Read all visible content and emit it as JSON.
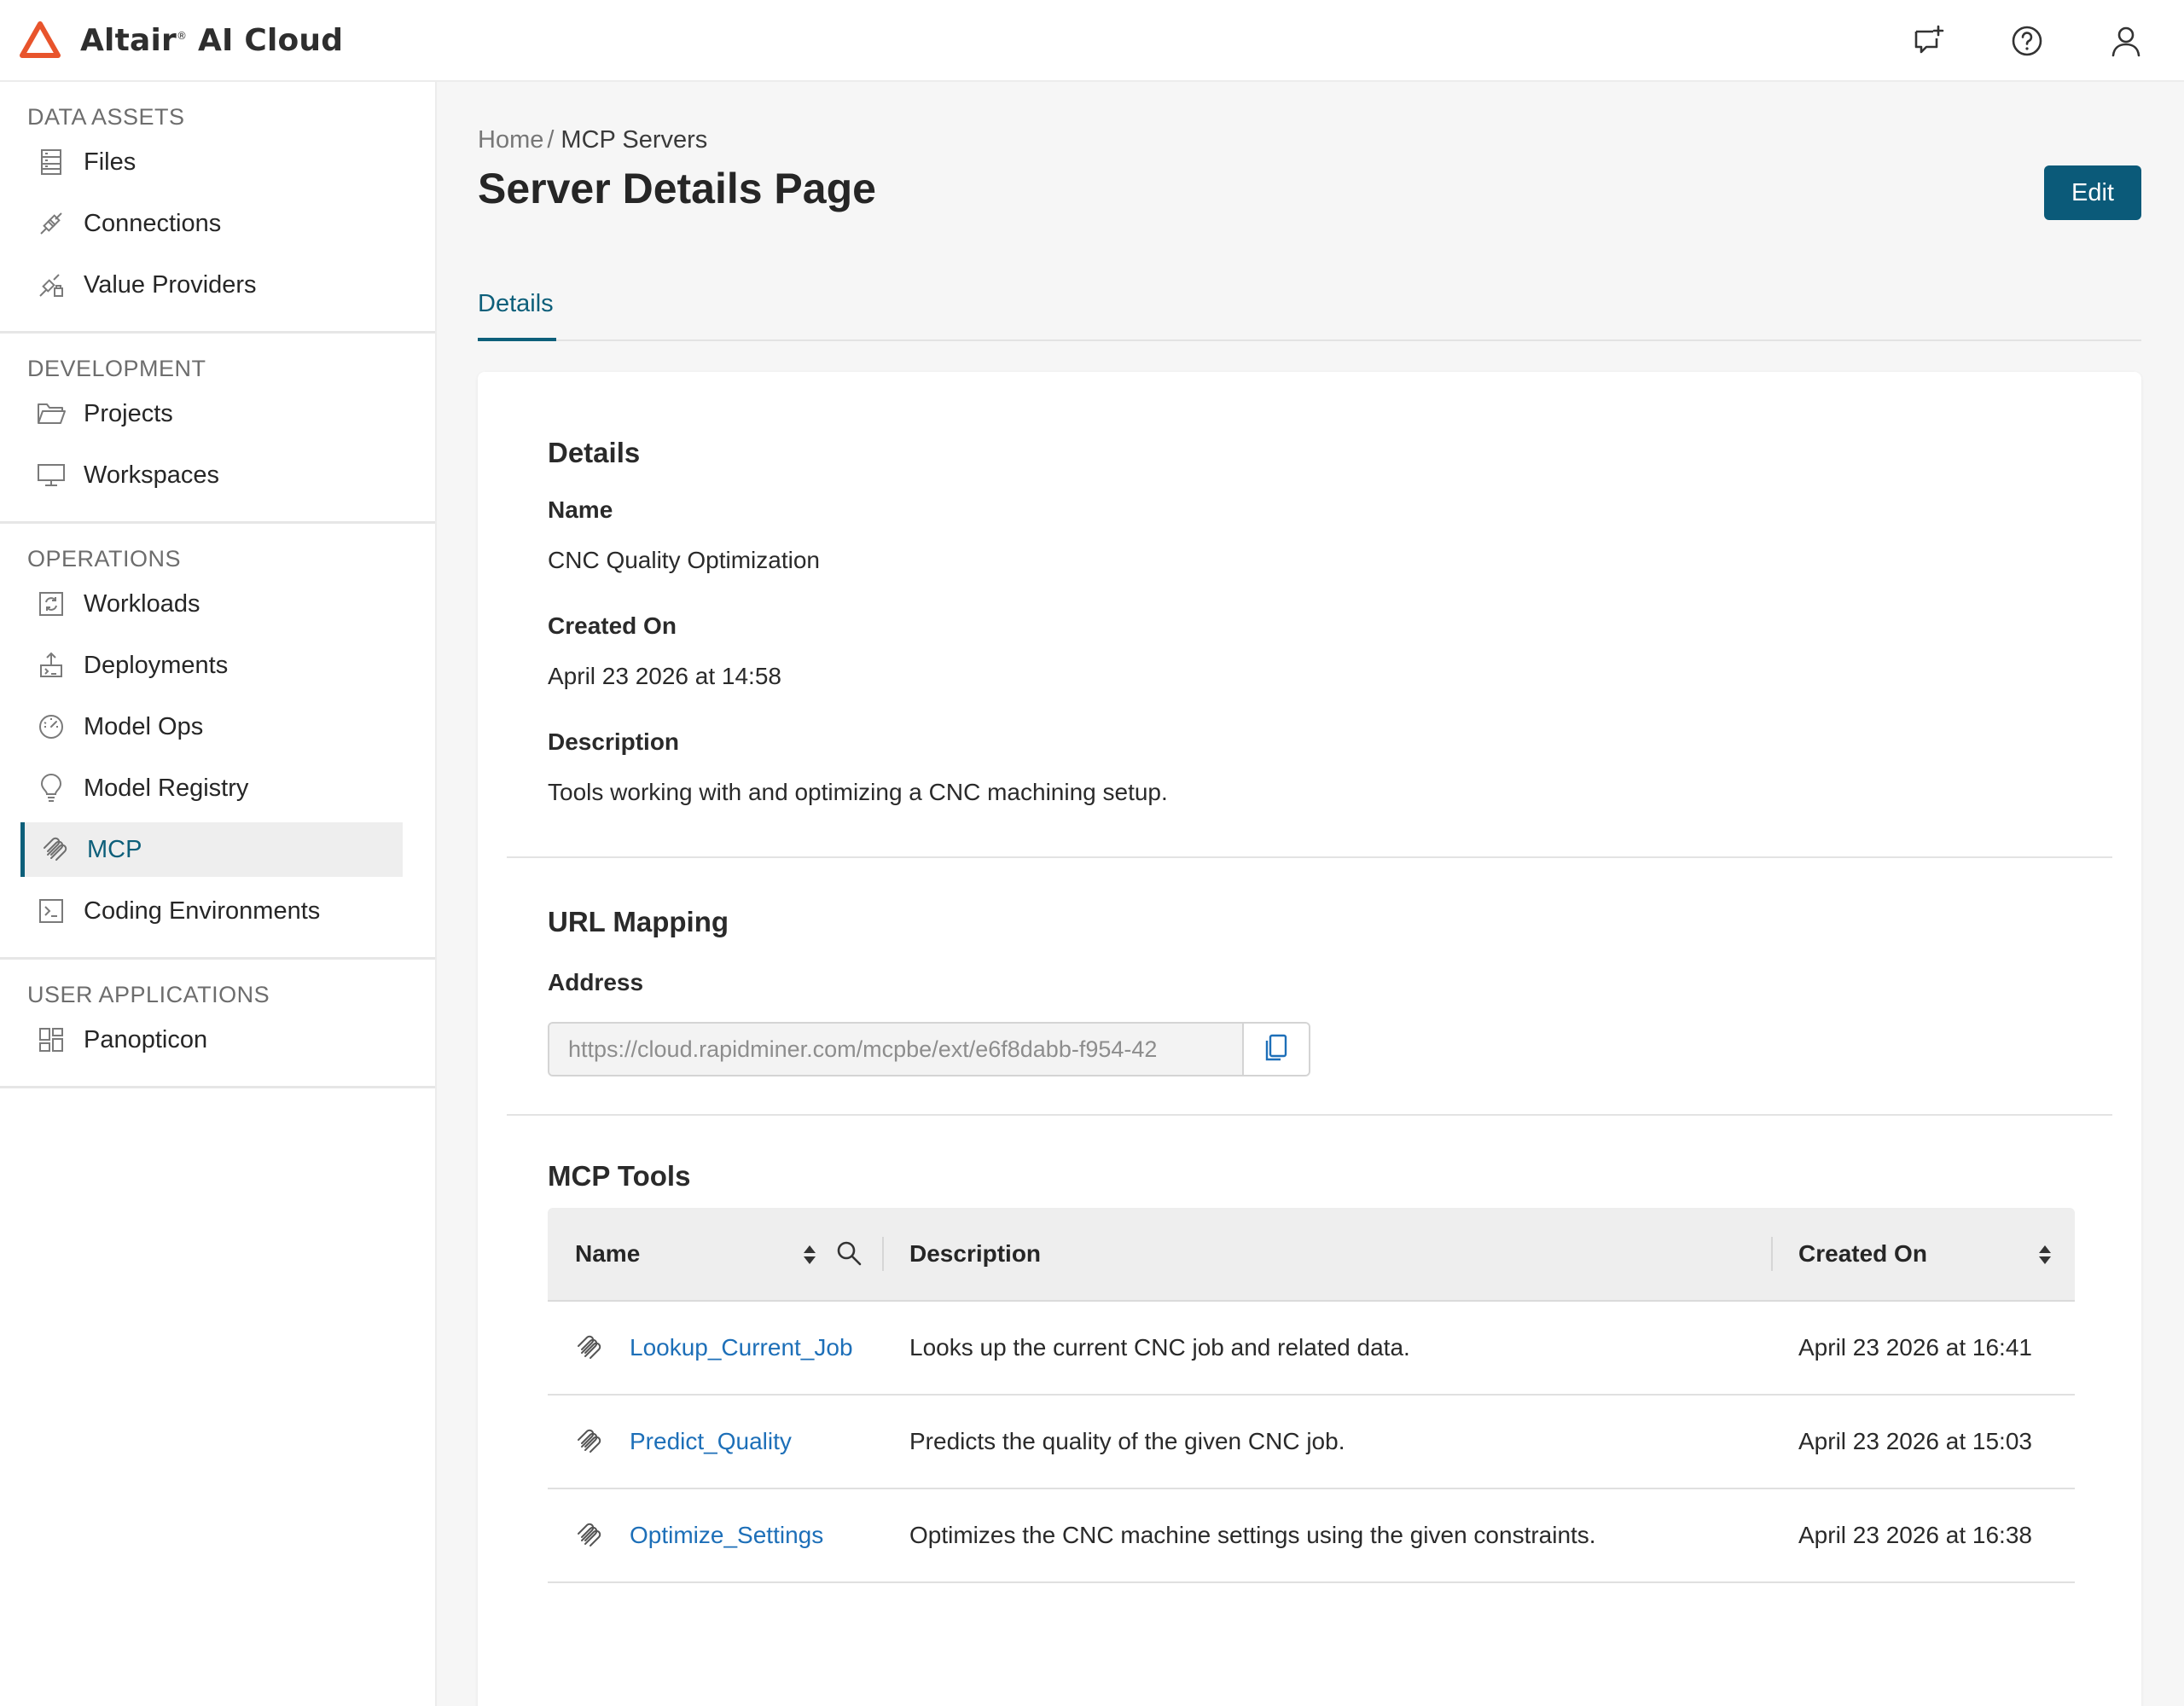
{
  "header": {
    "brand_name": "Altair",
    "brand_suffix": "AI Cloud",
    "brand_color": "#E8542C",
    "icons": [
      "feedback-icon",
      "help-icon",
      "user-icon"
    ]
  },
  "sidebar": {
    "sections": [
      {
        "title": "DATA ASSETS",
        "items": [
          {
            "label": "Files",
            "icon": "files-icon"
          },
          {
            "label": "Connections",
            "icon": "connections-icon"
          },
          {
            "label": "Value Providers",
            "icon": "value-providers-icon"
          }
        ]
      },
      {
        "title": "DEVELOPMENT",
        "items": [
          {
            "label": "Projects",
            "icon": "folder-icon"
          },
          {
            "label": "Workspaces",
            "icon": "monitor-icon"
          }
        ]
      },
      {
        "title": "OPERATIONS",
        "items": [
          {
            "label": "Workloads",
            "icon": "workloads-icon"
          },
          {
            "label": "Deployments",
            "icon": "deployments-icon"
          },
          {
            "label": "Model Ops",
            "icon": "gauge-icon"
          },
          {
            "label": "Model Registry",
            "icon": "lightbulb-icon"
          },
          {
            "label": "MCP",
            "icon": "mcp-icon",
            "active": true
          },
          {
            "label": "Coding Environments",
            "icon": "terminal-icon"
          }
        ]
      },
      {
        "title": "USER APPLICATIONS",
        "items": [
          {
            "label": "Panopticon",
            "icon": "dashboard-icon"
          }
        ]
      }
    ]
  },
  "breadcrumb": {
    "home": "Home",
    "separator": "/",
    "current": "MCP Servers"
  },
  "page": {
    "title": "Server Details Page",
    "edit_label": "Edit",
    "accent_color": "#0B5A79"
  },
  "tabs": [
    {
      "label": "Details",
      "active": true
    }
  ],
  "details": {
    "title": "Details",
    "name_label": "Name",
    "name_value": "CNC Quality Optimization",
    "created_label": "Created On",
    "created_value": "April 23 2026 at 14:58",
    "description_label": "Description",
    "description_value": "Tools working with and optimizing a CNC machining setup."
  },
  "url_mapping": {
    "title": "URL Mapping",
    "address_label": "Address",
    "address_value": "https://cloud.rapidminer.com/mcpbe/ext/e6f8dabb-f954-42"
  },
  "mcp_tools": {
    "title": "MCP Tools",
    "columns": {
      "name": "Name",
      "description": "Description",
      "created_on": "Created On"
    },
    "rows": [
      {
        "name": "Lookup_Current_Job",
        "description": "Looks up the current CNC job and related data.",
        "created_on": "April 23 2026 at 16:41"
      },
      {
        "name": "Predict_Quality",
        "description": "Predicts the quality of the given CNC job.",
        "created_on": "April 23 2026 at 15:03"
      },
      {
        "name": "Optimize_Settings",
        "description": "Optimizes the CNC machine settings using the given constraints.",
        "created_on": "April 23 2026 at 16:38"
      }
    ]
  }
}
